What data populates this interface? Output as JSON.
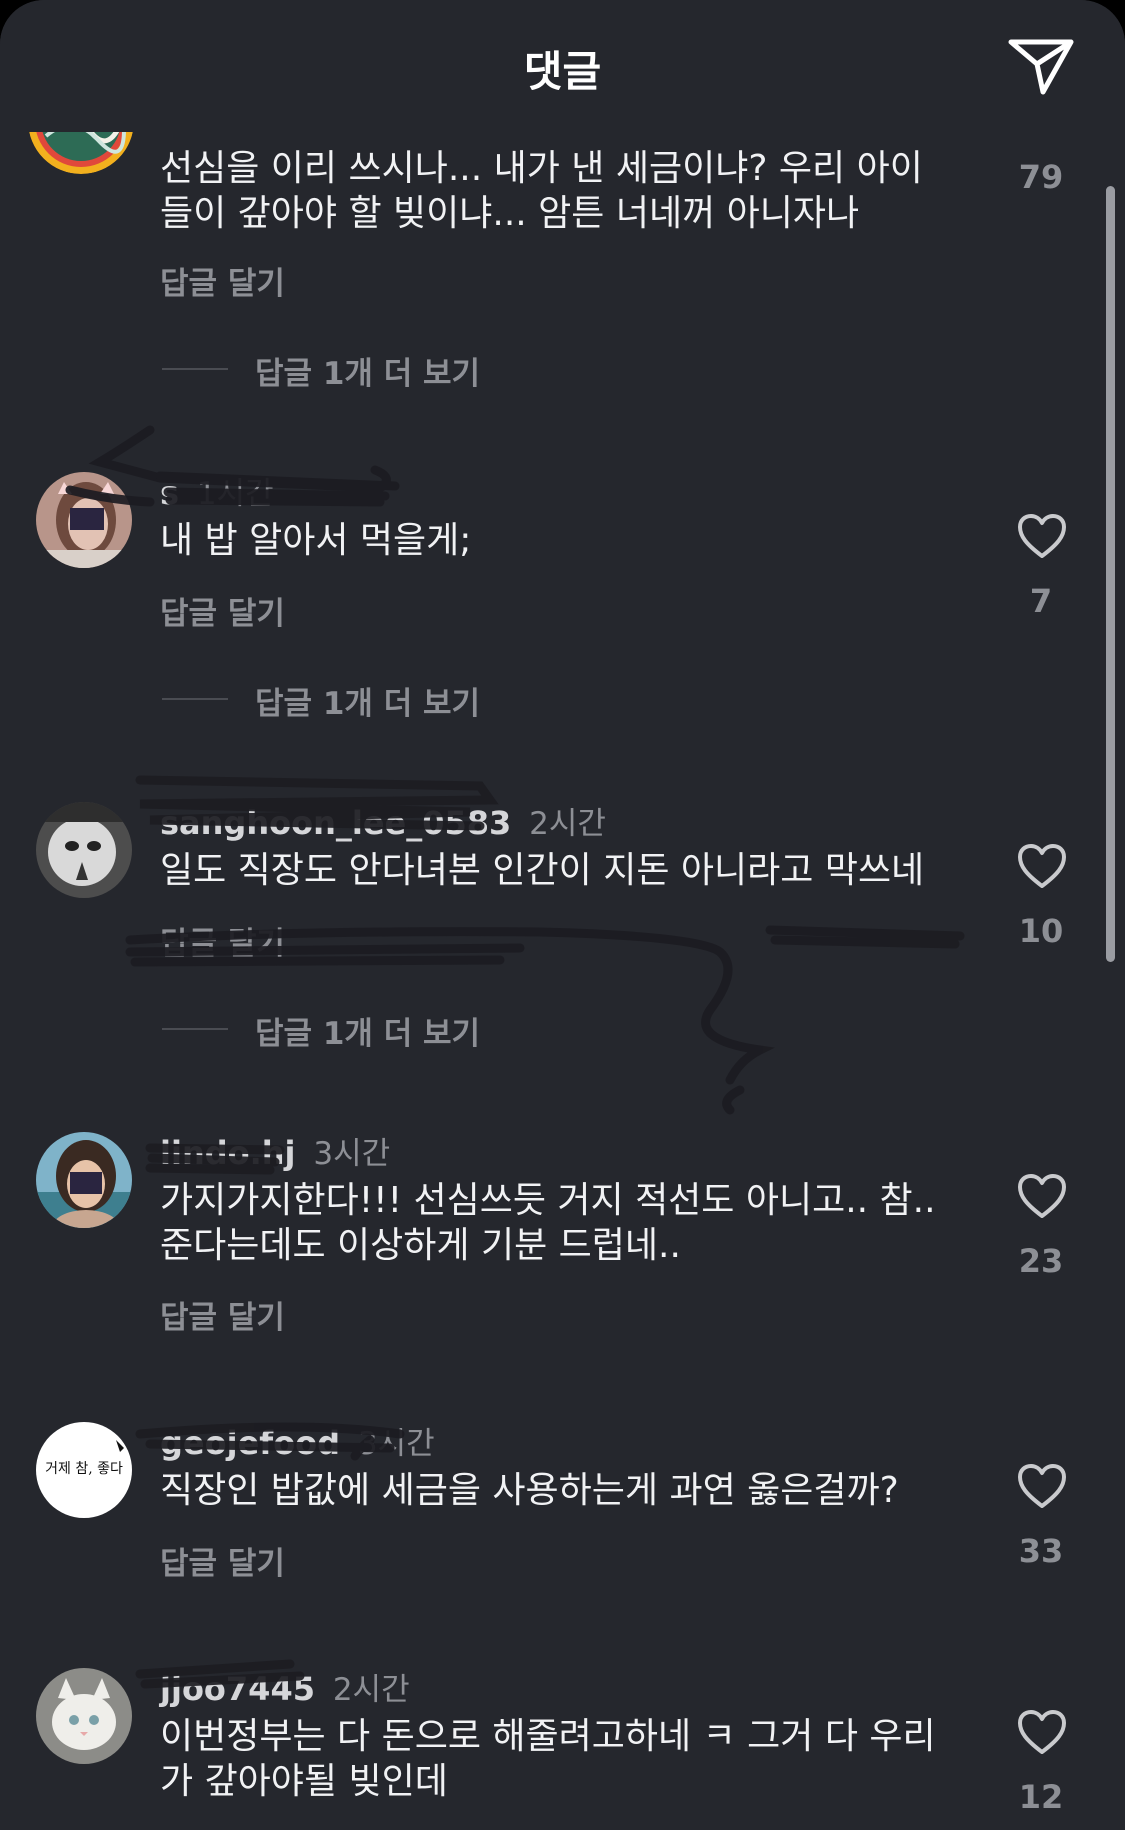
{
  "header": {
    "title": "댓글",
    "share_icon": "paper-plane-icon"
  },
  "comments": [
    {
      "username": "",
      "time": "",
      "text": "선심을 이리 쓰시나... 내가 낸 세금이냐? 우리 아이\n들이 갚아야 할 빚이냐... 암튼 너네꺼 아니자나",
      "reply_label": "답글 달기",
      "more_replies": "답글 1개 더 보기",
      "likes": "79"
    },
    {
      "username": "s",
      "time": "1시간",
      "text": "내 밥 알아서 먹을게;",
      "reply_label": "답글 달기",
      "more_replies": "답글 1개 더 보기",
      "likes": "7"
    },
    {
      "username": "sanghoon_lee_0583",
      "time": "2시간",
      "text": "일도 직장도 안다녀본 인간이 지돈 아니라고 막쓰네",
      "reply_label": "답글 달기",
      "more_replies": "답글 1개 더 보기",
      "likes": "10"
    },
    {
      "username": "lindo.hj",
      "time": "3시간",
      "text": "가지가지한다!!! 선심쓰듯 거지 적선도 아니고.. 참..\n준다는데도 이상하게 기분 드럽네..",
      "reply_label": "답글 달기",
      "likes": "23"
    },
    {
      "username": "geojefood",
      "time": "3시간",
      "text": "직장인 밥값에  세금을 사용하는게 과연 옳은걸까?",
      "reply_label": "답글 달기",
      "likes": "33",
      "avatar_text": "거제 참, 좋다"
    },
    {
      "username": "jjoo7445",
      "time": "2시간",
      "text": "이번정부는 다 돈으로 해줄려고하네 ㅋ 그거 다 우리\n가 갚아야될 빚인데",
      "likes": "12"
    }
  ],
  "colors": {
    "background": "#25272d",
    "text": "#f1f2f4",
    "muted": "#8d8f95",
    "heart": "#c9cacd"
  }
}
